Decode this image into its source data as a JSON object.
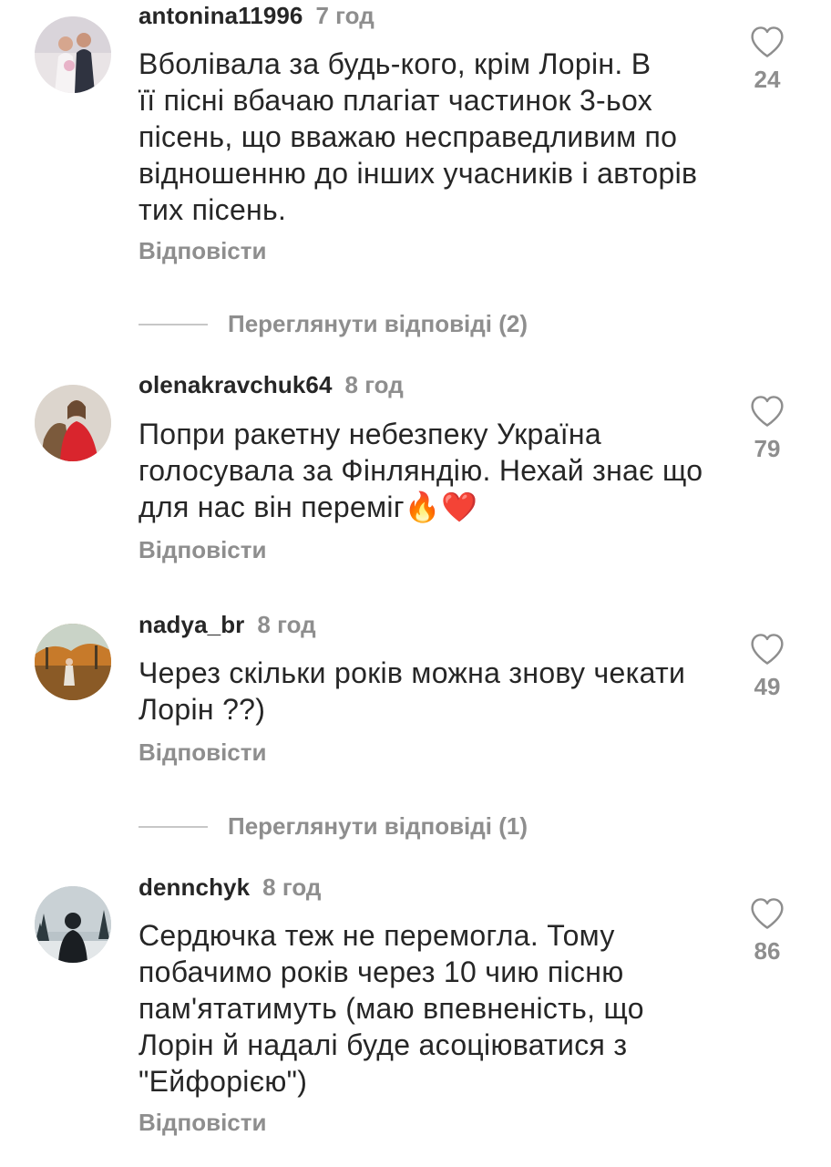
{
  "comments": [
    {
      "username": "antonina11996",
      "time": "7 год",
      "lines": [
        "Вболівала за будь-кого, крім Лорін. В",
        "її пісні вбачаю плагіат частинок 3-ьох",
        "пісень, що вважаю несправедливим по",
        "відношенню до інших учасників і авторів",
        "тих пісень."
      ],
      "likes": "24",
      "reply_label": "Відповісти",
      "view_replies": "Переглянути відповіді (2)"
    },
    {
      "username": "olenakravchuk64",
      "time": "8 год",
      "lines": [
        "Попри ракетну небезпеку Україна",
        "голосувала за Фінляндію. Нехай знає що",
        "для нас він переміг"
      ],
      "emoji": [
        "🔥",
        "❤️"
      ],
      "likes": "79",
      "reply_label": "Відповісти"
    },
    {
      "username": "nadya_br",
      "time": "8 год",
      "lines": [
        "Через скільки років можна знову чекати",
        "Лорін ??)"
      ],
      "likes": "49",
      "reply_label": "Відповісти",
      "view_replies": "Переглянути відповіді (1)"
    },
    {
      "username": "dennchyk",
      "time": "8 год",
      "lines": [
        "Сердючка теж не перемогла. Тому",
        "побачимо років через 10 чию пісню",
        "пам'ятатимуть (маю впевненість, що",
        "Лорін й надалі буде асоціюватися з",
        "\"Ейфорією\")"
      ],
      "likes": "86",
      "reply_label": "Відповісти"
    }
  ],
  "icons": {
    "like": "heart-outline-icon"
  },
  "colors": {
    "text": "#262626",
    "secondary": "#8e8e8e",
    "divider": "#c7c7c7"
  }
}
